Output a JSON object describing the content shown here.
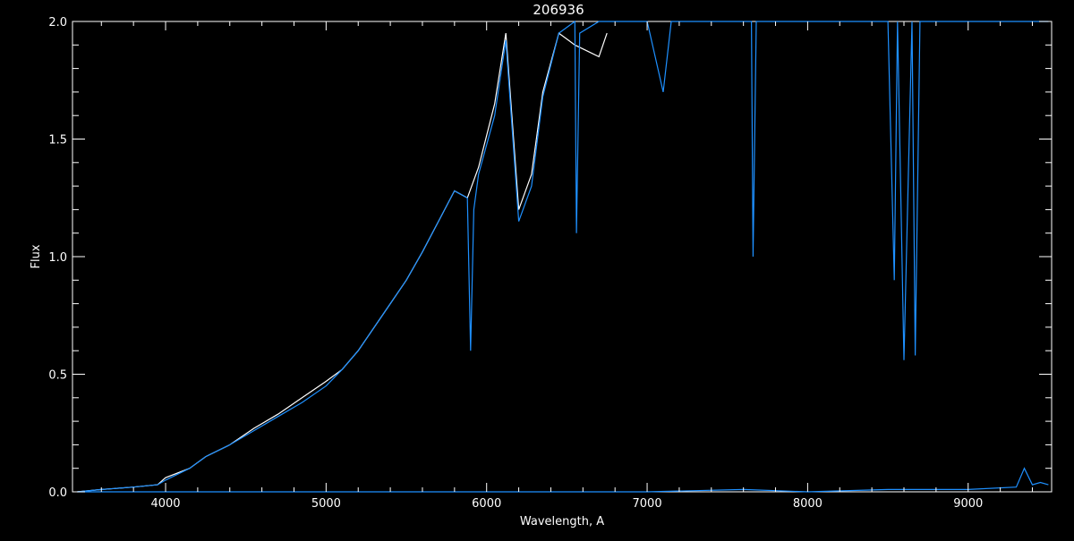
{
  "chart_data": {
    "type": "line",
    "title": "206936",
    "xlabel": "Wavelength, A",
    "ylabel": "Flux",
    "xlim": [
      3420,
      9520
    ],
    "ylim": [
      0.0,
      2.0
    ],
    "x_ticks": [
      4000,
      5000,
      6000,
      7000,
      8000,
      9000
    ],
    "x_tick_labels": [
      "4000",
      "5000",
      "6000",
      "7000",
      "8000",
      "9000"
    ],
    "y_ticks": [
      0.0,
      0.5,
      1.0,
      1.5,
      2.0
    ],
    "y_tick_labels": [
      "0.0",
      "0.5",
      "1.0",
      "1.5",
      "2.0"
    ],
    "grid": false,
    "background": "#000000",
    "axis_color": "#ffffff",
    "series": [
      {
        "color": "#ffffff",
        "x": [
          3450,
          3600,
          3800,
          3950,
          4000,
          4150,
          4250,
          4400,
          4550,
          4700,
          4850,
          5000,
          5100,
          5200,
          5300,
          5400,
          5500,
          5600,
          5700,
          5800,
          5880,
          5950,
          6050,
          6120,
          6200,
          6280,
          6350,
          6450,
          6550,
          6700,
          6750
        ],
        "y": [
          0.0,
          0.01,
          0.02,
          0.03,
          0.06,
          0.1,
          0.15,
          0.2,
          0.27,
          0.33,
          0.4,
          0.47,
          0.52,
          0.6,
          0.7,
          0.8,
          0.9,
          1.02,
          1.15,
          1.28,
          1.25,
          1.38,
          1.65,
          1.95,
          1.2,
          1.35,
          1.7,
          1.95,
          1.9,
          1.85,
          1.95
        ]
      },
      {
        "color": "#1e90ff",
        "x": [
          3450,
          3600,
          3800,
          3950,
          4000,
          4150,
          4250,
          4400,
          4550,
          4700,
          4850,
          5000,
          5100,
          5200,
          5300,
          5400,
          5500,
          5600,
          5700,
          5800,
          5880,
          5900,
          5920,
          5950,
          6050,
          6120,
          6200,
          6280,
          6350,
          6450,
          6550,
          6560,
          6580,
          6700,
          6750,
          6800,
          7000,
          7100,
          7150,
          7200,
          7300,
          7500,
          7650,
          7660,
          7680,
          7700,
          8000,
          8200,
          8300,
          8450,
          8500,
          8540,
          8560,
          8600,
          8650,
          8670,
          8700,
          8850,
          9000,
          9200,
          9300,
          9350,
          9400,
          9450,
          9500
        ],
        "y": [
          0.0,
          0.01,
          0.02,
          0.03,
          0.05,
          0.1,
          0.15,
          0.2,
          0.26,
          0.32,
          0.38,
          0.45,
          0.52,
          0.6,
          0.7,
          0.8,
          0.9,
          1.02,
          1.15,
          1.28,
          1.25,
          0.6,
          1.2,
          1.35,
          1.6,
          1.92,
          1.15,
          1.3,
          1.68,
          1.95,
          2.0,
          1.1,
          1.95,
          2.0,
          2.0,
          2.0,
          2.0,
          1.7,
          2.0,
          2.0,
          2.0,
          2.0,
          2.0,
          1.0,
          2.0,
          2.0,
          2.0,
          2.0,
          2.0,
          2.0,
          2.0,
          0.9,
          2.0,
          0.56,
          2.0,
          0.58,
          2.0,
          2.0,
          2.0,
          2.0,
          2.0,
          2.0,
          2.0,
          2.0,
          2.0
        ]
      },
      {
        "color": "#1e90ff",
        "x": [
          3450,
          5000,
          7000,
          7600,
          8000,
          8500,
          9000,
          9300,
          9350,
          9400,
          9450,
          9500
        ],
        "y": [
          0.0,
          0.0,
          0.0,
          0.01,
          0.0,
          0.01,
          0.01,
          0.02,
          0.1,
          0.03,
          0.04,
          0.03
        ]
      }
    ]
  }
}
